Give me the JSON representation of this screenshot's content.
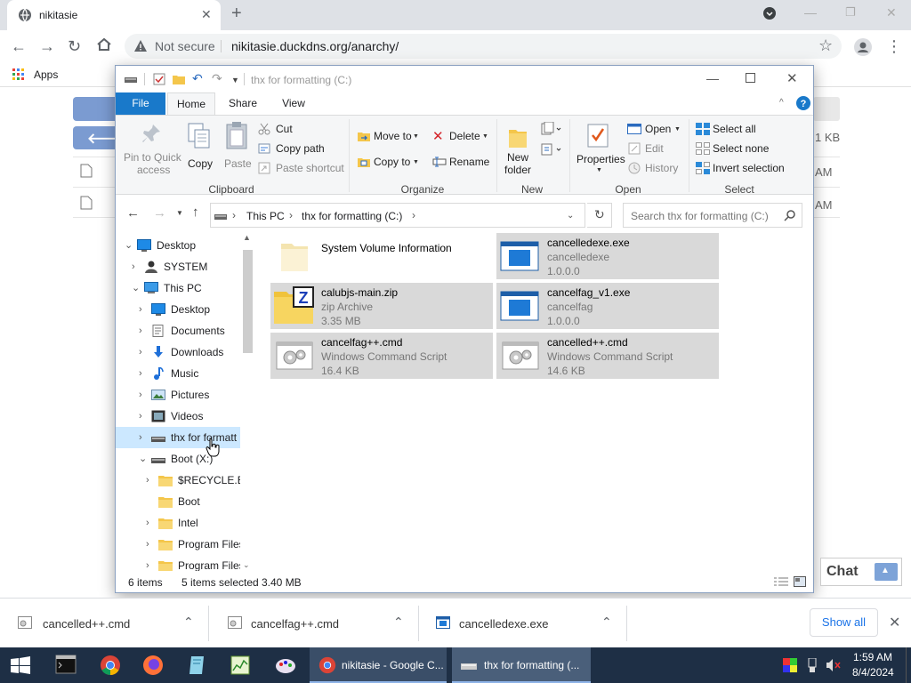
{
  "browser": {
    "tab_title": "nikitasie",
    "not_secure": "Not secure",
    "url": "nikitasie.duckdns.org/anarchy/",
    "bookmarks_apps": "Apps"
  },
  "page_behind": {
    "sizes": [
      "1 KB"
    ],
    "times": [
      "AM",
      "AM"
    ]
  },
  "explorer": {
    "title": "thx for formatting (C:)",
    "ribbon_tabs": [
      "File",
      "Home",
      "Share",
      "View"
    ],
    "clipboard": {
      "pin": "Pin to Quick",
      "pin2": "access",
      "copy": "Copy",
      "paste": "Paste",
      "cut": "Cut",
      "copy_path": "Copy path",
      "paste_shortcut": "Paste shortcut",
      "group": "Clipboard"
    },
    "organize": {
      "move_to": "Move to",
      "copy_to": "Copy to",
      "delete": "Delete",
      "rename": "Rename",
      "group": "Organize"
    },
    "new": {
      "new_folder": "New",
      "new_folder2": "folder",
      "group": "New"
    },
    "open": {
      "properties": "Properties",
      "open": "Open",
      "edit": "Edit",
      "history": "History",
      "group": "Open"
    },
    "select": {
      "select_all": "Select all",
      "select_none": "Select none",
      "invert": "Invert selection",
      "group": "Select"
    },
    "breadcrumb": [
      "This PC",
      "thx for formatting (C:)"
    ],
    "search_placeholder": "Search thx for formatting (C:)",
    "nav": [
      {
        "label": "Desktop",
        "lvl": 0,
        "chev": "v"
      },
      {
        "label": "SYSTEM",
        "lvl": 1,
        "chev": ">"
      },
      {
        "label": "This PC",
        "lvl": 1,
        "chev": "v"
      },
      {
        "label": "Desktop",
        "lvl": 2,
        "chev": ">"
      },
      {
        "label": "Documents",
        "lvl": 2,
        "chev": ">"
      },
      {
        "label": "Downloads",
        "lvl": 2,
        "chev": ">"
      },
      {
        "label": "Music",
        "lvl": 2,
        "chev": ">"
      },
      {
        "label": "Pictures",
        "lvl": 2,
        "chev": ">"
      },
      {
        "label": "Videos",
        "lvl": 2,
        "chev": ">"
      },
      {
        "label": "thx for formatt",
        "lvl": 2,
        "chev": ">"
      },
      {
        "label": "Boot (X:)",
        "lvl": 2,
        "chev": "v"
      },
      {
        "label": "$RECYCLE.BIN",
        "lvl": 3,
        "chev": ">"
      },
      {
        "label": "Boot",
        "lvl": 3,
        "chev": ""
      },
      {
        "label": "Intel",
        "lvl": 3,
        "chev": ">"
      },
      {
        "label": "Program Files",
        "lvl": 3,
        "chev": ">"
      },
      {
        "label": "Program Files",
        "lvl": 3,
        "chev": ">"
      }
    ],
    "files": [
      {
        "name": "System Volume Information",
        "l1": "",
        "l2": "",
        "selected": false
      },
      {
        "name": "cancelledexe.exe",
        "l1": "cancelledexe",
        "l2": "1.0.0.0",
        "selected": true
      },
      {
        "name": "calubjs-main.zip",
        "l1": "zip Archive",
        "l2": "3.35 MB",
        "selected": true
      },
      {
        "name": "cancelfag_v1.exe",
        "l1": "cancelfag",
        "l2": "1.0.0.0",
        "selected": true
      },
      {
        "name": "cancelfag++.cmd",
        "l1": "Windows Command Script",
        "l2": "16.4 KB",
        "selected": true
      },
      {
        "name": "cancelled++.cmd",
        "l1": "Windows Command Script",
        "l2": "14.6 KB",
        "selected": true
      }
    ],
    "status_items": "6 items",
    "status_selected": "5 items selected",
    "status_size": "3.40 MB"
  },
  "chat": {
    "label": "Chat"
  },
  "downloads": {
    "items": [
      "cancelled++.cmd",
      "cancelfag++.cmd",
      "cancelledexe.exe"
    ],
    "show_all": "Show all"
  },
  "taskbar": {
    "chrome_task": "nikitasie - Google C...",
    "explorer_task": "thx for formatting (...",
    "time": "1:59 AM",
    "date": "8/4/2024"
  },
  "colors": {
    "selection": "#d9d9d9",
    "nav_selected": "#cce8ff",
    "ribbon_file_tab": "#1979ca",
    "taskbar": "#1e2f45"
  }
}
